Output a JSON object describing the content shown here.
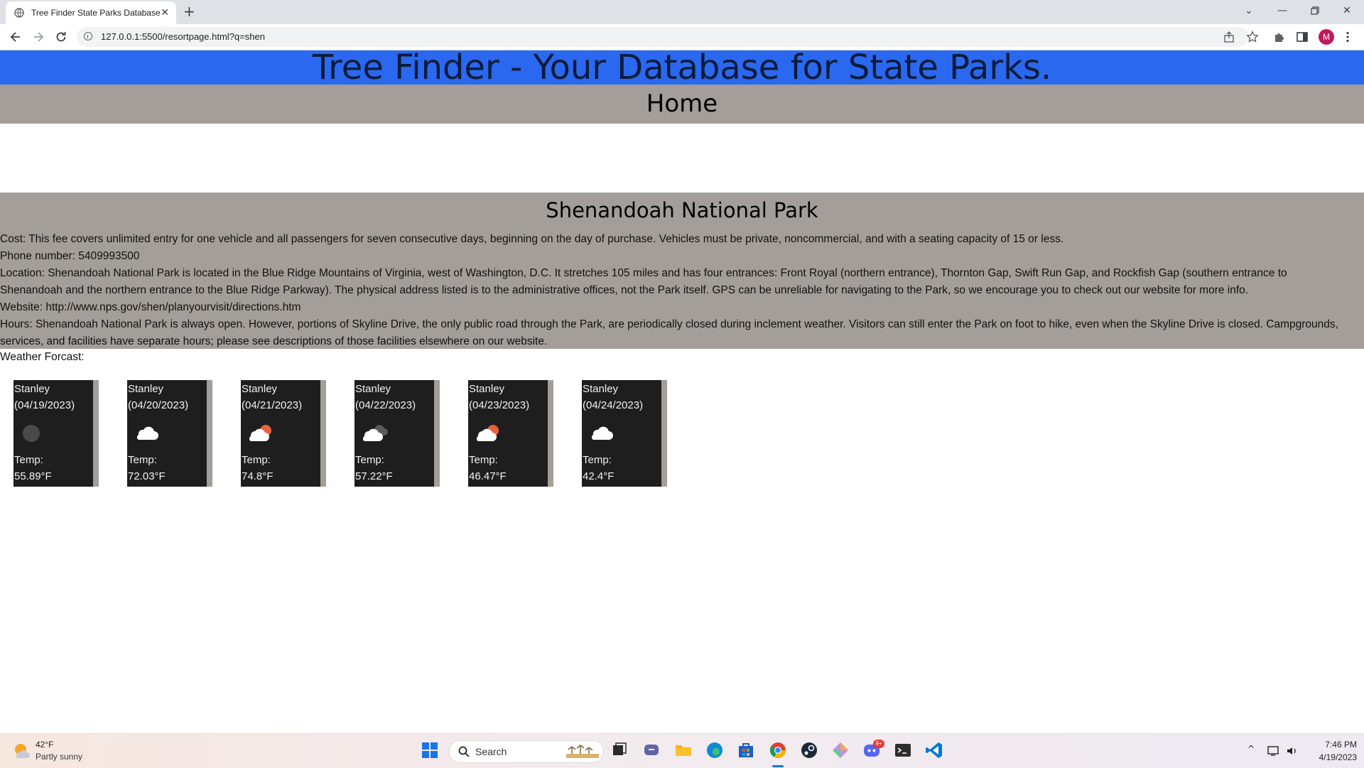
{
  "browser": {
    "tab_title": "Tree Finder State Parks Database",
    "url": "127.0.0.1:5500/resortpage.html?q=shen",
    "profile_initial": "M"
  },
  "site": {
    "banner": "Tree Finder - Your Database for State Parks.",
    "home_link": "Home"
  },
  "park": {
    "name": "Shenandoah National Park",
    "cost": "Cost: This fee covers unlimited entry for one vehicle and all passengers for seven consecutive days, beginning on the day of purchase. Vehicles must be private, noncommercial, and with a seating capacity of 15 or less.",
    "phone": "Phone number: 5409993500",
    "location": "Location: Shenandoah National Park is located in the Blue Ridge Mountains of Virginia, west of Washington, D.C. It stretches 105 miles and has four entrances: Front Royal (northern entrance), Thornton Gap, Swift Run Gap, and Rockfish Gap (southern entrance to Shenandoah and the northern entrance to the Blue Ridge Parkway). The physical address listed is to the administrative offices, not the Park itself. GPS can be unreliable for navigating to the Park, so we encourage you to check out our website for more info.",
    "website": "Website: http://www.nps.gov/shen/planyourvisit/directions.htm",
    "hours": "Hours: Shenandoah National Park is always open. However, portions of Skyline Drive, the only public road through the Park, are periodically closed during inclement weather. Visitors can still enter the Park on foot to hike, even when the Skyline Drive is closed. Campgrounds, services, and facilities have separate hours; please see descriptions of those facilities elsewhere on our website."
  },
  "forecast": {
    "label": "Weather Forcast:",
    "days": [
      {
        "city": "Stanley",
        "date": "(04/19/2023)",
        "temp_label": "Temp:",
        "temp": "55.89°F",
        "icon": "night-clear-icon"
      },
      {
        "city": "Stanley",
        "date": "(04/20/2023)",
        "temp_label": "Temp:",
        "temp": "72.03°F",
        "icon": "cloud-icon"
      },
      {
        "city": "Stanley",
        "date": "(04/21/2023)",
        "temp_label": "Temp:",
        "temp": "74.8°F",
        "icon": "partly-cloudy-icon"
      },
      {
        "city": "Stanley",
        "date": "(04/22/2023)",
        "temp_label": "Temp:",
        "temp": "57.22°F",
        "icon": "cloudy-icon"
      },
      {
        "city": "Stanley",
        "date": "(04/23/2023)",
        "temp_label": "Temp:",
        "temp": "46.47°F",
        "icon": "partly-cloudy-icon"
      },
      {
        "city": "Stanley",
        "date": "(04/24/2023)",
        "temp_label": "Temp:",
        "temp": "42.4°F",
        "icon": "cloud-icon"
      }
    ]
  },
  "taskbar": {
    "weather_temp": "42°F",
    "weather_desc": "Partly sunny",
    "search_label": "Search",
    "time": "7:46 PM",
    "date": "4/19/2023",
    "notification_badge": "9+"
  },
  "colors": {
    "banner": "#2a68ef",
    "gray_band": "#a39e99",
    "card_bg": "#1f1e1e"
  }
}
